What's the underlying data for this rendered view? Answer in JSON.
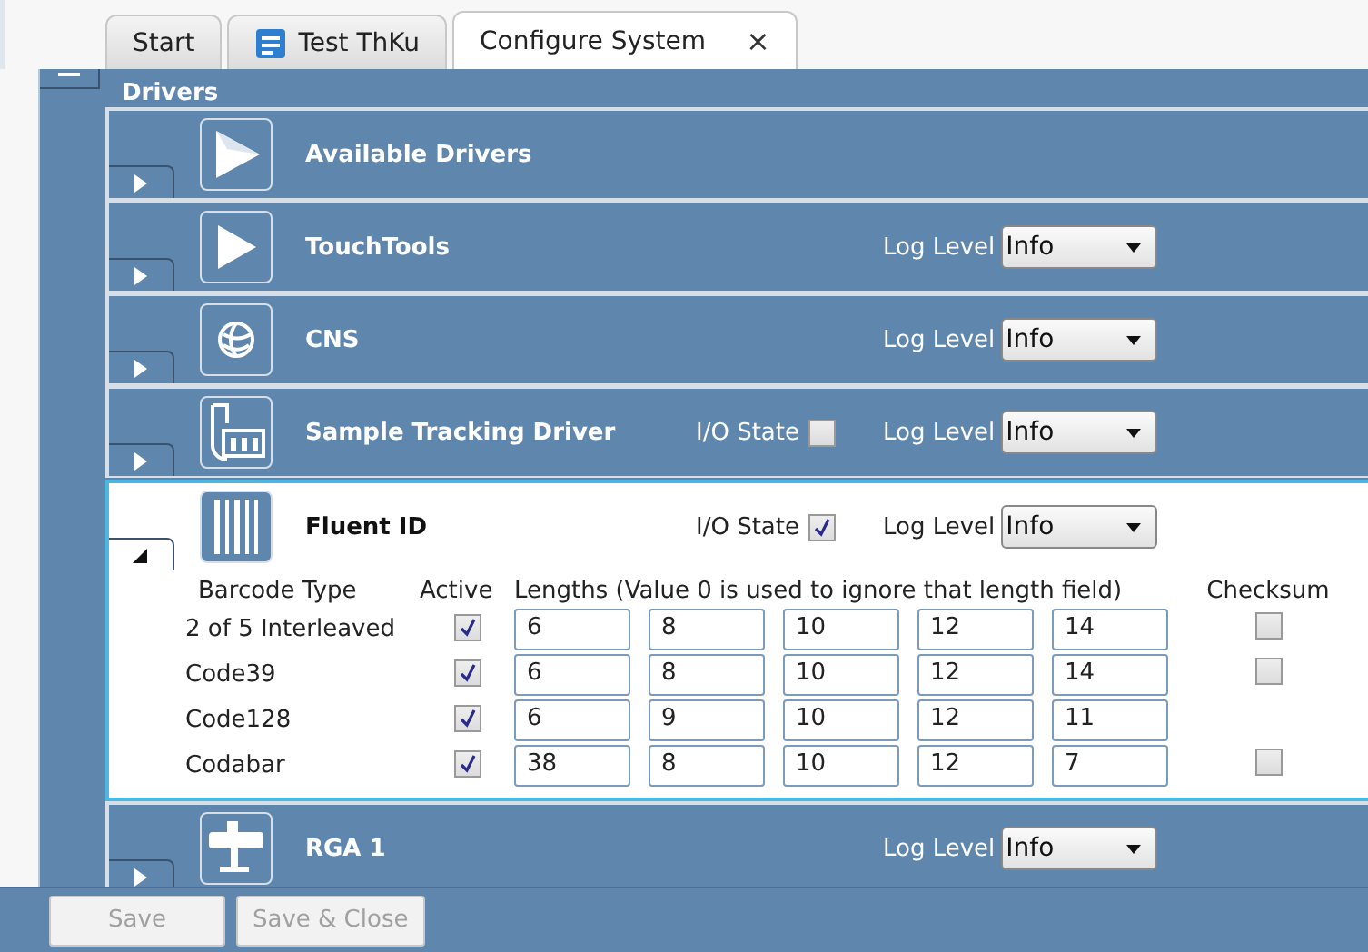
{
  "tabs": [
    {
      "label": "Start",
      "selected": false,
      "kind": "plain"
    },
    {
      "label": "Test ThKu",
      "selected": false,
      "kind": "document"
    },
    {
      "label": "Configure System",
      "selected": true,
      "kind": "plain",
      "close": "×"
    }
  ],
  "section": {
    "title": "Drivers",
    "expanded": true
  },
  "drivers": [
    {
      "name": "Available Drivers",
      "expanded": false
    },
    {
      "name": "TouchTools",
      "expanded": false,
      "log_label": "Log Level",
      "log_level": "Info"
    },
    {
      "name": "CNS",
      "expanded": false,
      "log_label": "Log Level",
      "log_level": "Info"
    },
    {
      "name": "Sample Tracking Driver",
      "expanded": false,
      "io_label": "I/O State",
      "io_state": false,
      "log_label": "Log Level",
      "log_level": "Info"
    },
    {
      "name": "Fluent ID",
      "expanded": true,
      "io_label": "I/O State",
      "io_state": true,
      "log_label": "Log Level",
      "log_level": "Info",
      "table": {
        "columns": [
          "Barcode Type",
          "Active",
          "Lengths (Value 0 is used to ignore that length field)",
          "Checksum"
        ],
        "rows": [
          {
            "type": "2 of 5 Interleaved",
            "active": true,
            "lengths": [
              "6",
              "8",
              "10",
              "12",
              "14"
            ],
            "checksum": false
          },
          {
            "type": "Code39",
            "active": true,
            "lengths": [
              "6",
              "8",
              "10",
              "12",
              "14"
            ],
            "checksum": false
          },
          {
            "type": "Code128",
            "active": true,
            "lengths": [
              "6",
              "9",
              "10",
              "12",
              "11"
            ]
          },
          {
            "type": "Codabar",
            "active": true,
            "lengths": [
              "38",
              "8",
              "10",
              "12",
              "7"
            ],
            "checksum": false
          }
        ]
      }
    },
    {
      "name": "RGA 1",
      "expanded": false,
      "log_label": "Log Level",
      "log_level": "Info"
    }
  ],
  "buttons": [
    {
      "label": "Save",
      "disabled": true
    },
    {
      "label": "Save & Close",
      "disabled": true
    }
  ]
}
